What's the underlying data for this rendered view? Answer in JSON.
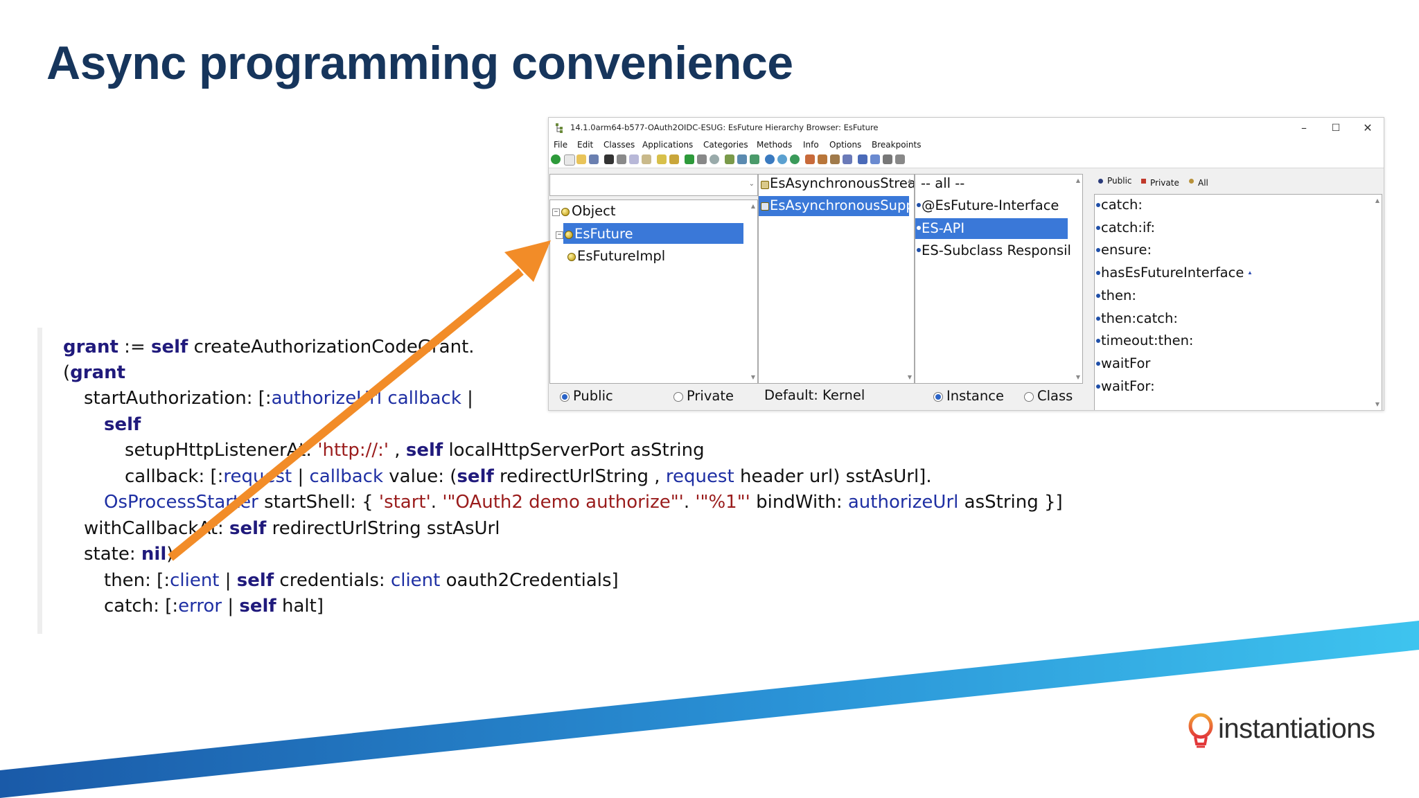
{
  "slide": {
    "title": "Async programming convenience"
  },
  "code": {
    "lines": [
      [
        {
          "t": "grant",
          "c": "kw"
        },
        {
          "t": " := ",
          "c": ""
        },
        {
          "t": "self",
          "c": "kw"
        },
        {
          "t": " createAuthorizationCodeGrant.",
          "c": ""
        }
      ],
      [
        {
          "t": "(",
          "c": ""
        },
        {
          "t": "grant",
          "c": "kw"
        }
      ],
      [
        {
          "t": "startAuthorization: [:",
          "c": ""
        },
        {
          "t": "authorizeUrl",
          "c": "var"
        },
        {
          "t": " ",
          "c": ""
        },
        {
          "t": "callback",
          "c": "var"
        },
        {
          "t": " |",
          "c": ""
        }
      ],
      [
        {
          "t": "self",
          "c": "kw"
        }
      ],
      [
        {
          "t": "setupHttpListenerAt: ",
          "c": ""
        },
        {
          "t": "'http://:'",
          "c": "str"
        },
        {
          "t": " , ",
          "c": ""
        },
        {
          "t": "self",
          "c": "kw"
        },
        {
          "t": " localHttpServerPort asString",
          "c": ""
        }
      ],
      [
        {
          "t": "callback: [:",
          "c": ""
        },
        {
          "t": "request",
          "c": "var"
        },
        {
          "t": " | ",
          "c": ""
        },
        {
          "t": "callback",
          "c": "var"
        },
        {
          "t": " value: (",
          "c": ""
        },
        {
          "t": "self",
          "c": "kw"
        },
        {
          "t": " redirectUrlString , ",
          "c": ""
        },
        {
          "t": "request",
          "c": "var"
        },
        {
          "t": " header url) sstAsUrl].",
          "c": ""
        }
      ],
      [
        {
          "t": "OsProcessStarter",
          "c": "var"
        },
        {
          "t": " startShell: { ",
          "c": ""
        },
        {
          "t": "'start'",
          "c": "str"
        },
        {
          "t": ". ",
          "c": ""
        },
        {
          "t": "'\"OAuth2 demo authorize\"'",
          "c": "str"
        },
        {
          "t": ". ",
          "c": ""
        },
        {
          "t": "'\"%1\"'",
          "c": "str"
        },
        {
          "t": " bindWith: ",
          "c": ""
        },
        {
          "t": "authorizeUrl",
          "c": "var"
        },
        {
          "t": " asString }]",
          "c": ""
        }
      ],
      [
        {
          "t": "withCallbackAt: ",
          "c": ""
        },
        {
          "t": "self",
          "c": "kw"
        },
        {
          "t": " redirectUrlString sstAsUrl",
          "c": ""
        }
      ],
      [
        {
          "t": "state: ",
          "c": ""
        },
        {
          "t": "nil",
          "c": "kw"
        },
        {
          "t": ")",
          "c": ""
        }
      ],
      [
        {
          "t": "then: [:",
          "c": ""
        },
        {
          "t": "client",
          "c": "var"
        },
        {
          "t": " | ",
          "c": ""
        },
        {
          "t": "self",
          "c": "kw"
        },
        {
          "t": " credentials: ",
          "c": ""
        },
        {
          "t": "client",
          "c": "var"
        },
        {
          "t": " oauth2Credentials]",
          "c": ""
        }
      ],
      [
        {
          "t": "catch: [:",
          "c": ""
        },
        {
          "t": "error",
          "c": "var"
        },
        {
          "t": " | ",
          "c": ""
        },
        {
          "t": "self",
          "c": "kw"
        },
        {
          "t": " halt]",
          "c": ""
        }
      ]
    ]
  },
  "window": {
    "title": "14.1.0arm64-b577-OAuth2OIDC-ESUG: EsFuture Hierarchy Browser: EsFuture",
    "controls": {
      "minimize": "–",
      "maximize": "☐",
      "close": "✕"
    },
    "menu": [
      "File",
      "Edit",
      "Classes",
      "Applications",
      "Categories",
      "Methods",
      "Info",
      "Options",
      "Breakpoints"
    ],
    "class_pane": {
      "items": [
        "Object",
        "EsFuture",
        "EsFutureImpl"
      ],
      "selected": "EsFuture",
      "radio_public": "Public",
      "radio_private": "Private",
      "radio_selected": "Public"
    },
    "app_pane": {
      "items": [
        "EsAsynchronousStrea",
        "EsAsynchronousSupp"
      ],
      "selected": "EsAsynchronousSupp",
      "footer": "Default: Kernel"
    },
    "category_pane": {
      "items": [
        "-- all --",
        "@EsFuture-Interface",
        "ES-API",
        "ES-Subclass Responsil"
      ],
      "selected": "ES-API",
      "radio_instance": "Instance",
      "radio_class": "Class",
      "radio_selected": "Instance"
    },
    "method_pane": {
      "tabs": [
        "Public",
        "Private",
        "All"
      ],
      "items": [
        "catch:",
        "catch:if:",
        "ensure:",
        "hasEsFutureInterface",
        "then:",
        "then:catch:",
        "timeout:then:",
        "waitFor",
        "waitFor:"
      ]
    }
  },
  "colors": {
    "title": "#16355c",
    "arrow": "#f28c28",
    "keyword": "#201a7c",
    "variable": "#1e2fa3",
    "string": "#9a1c1c",
    "selection": "#3a78d8",
    "band_start": "#1a5aa8",
    "band_end": "#3ec4ef"
  },
  "brand": {
    "name": "instantiations"
  }
}
